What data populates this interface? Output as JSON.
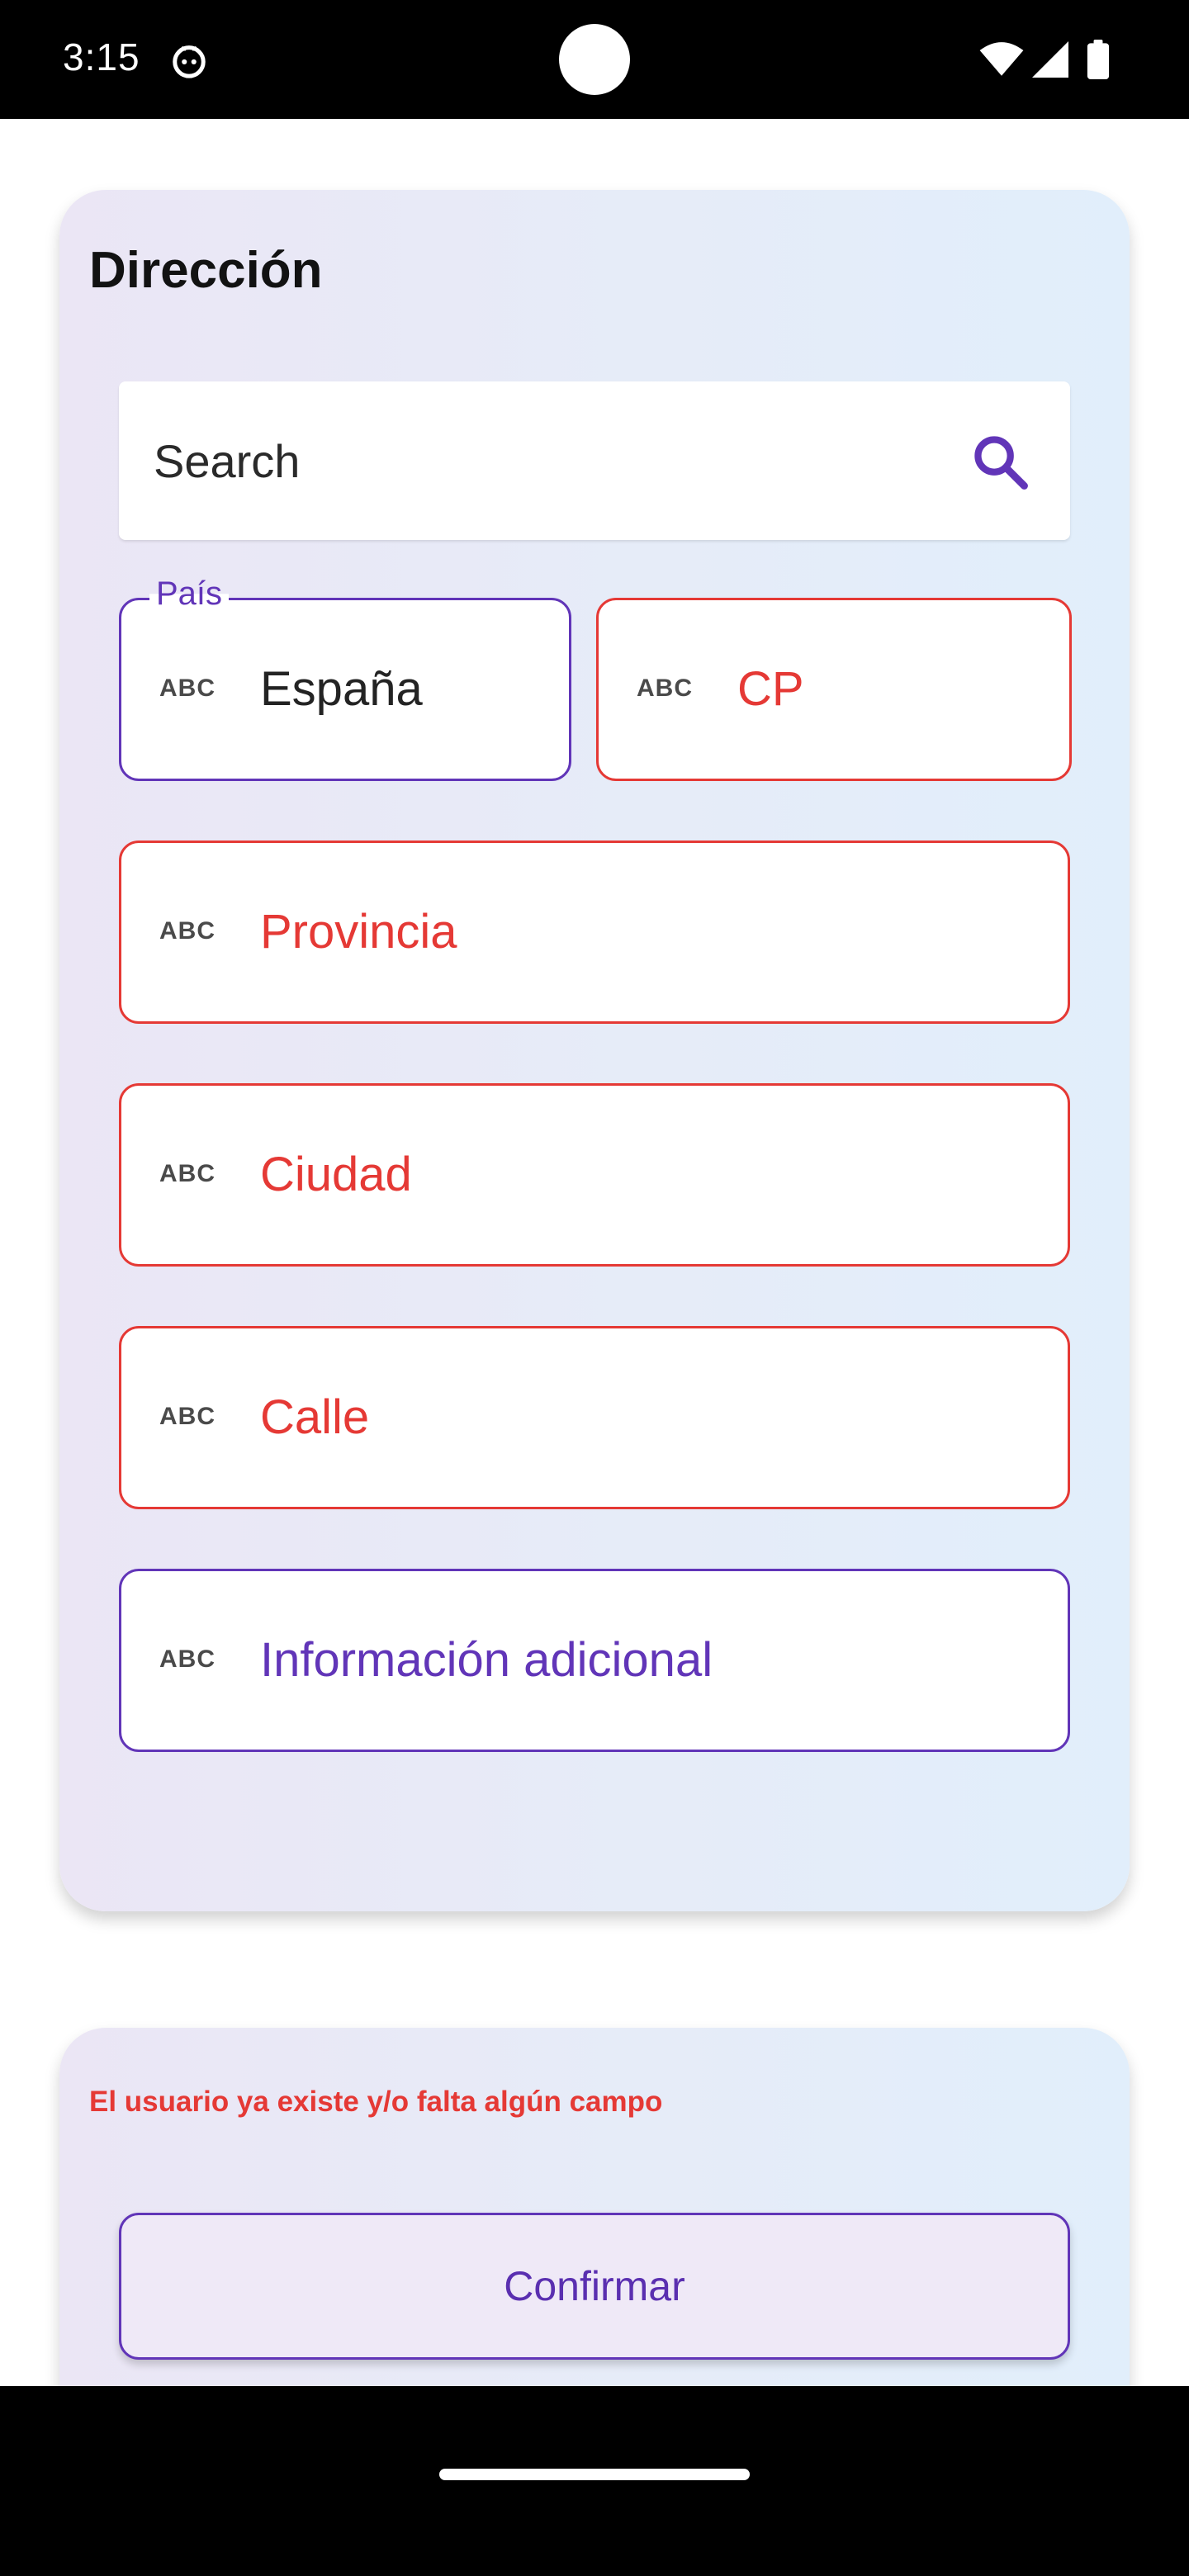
{
  "status_bar": {
    "time": "3:15",
    "icons": [
      "app-notification-icon",
      "wifi-icon",
      "signal-icon",
      "battery-icon"
    ]
  },
  "address_card": {
    "title": "Dirección",
    "search": {
      "placeholder": "Search",
      "icon": "search-icon"
    },
    "fields": {
      "country": {
        "label": "País",
        "value": "España",
        "type_icon": "ABC"
      },
      "postal_code": {
        "placeholder": "CP",
        "type_icon": "ABC"
      },
      "province": {
        "placeholder": "Provincia",
        "type_icon": "ABC"
      },
      "city": {
        "placeholder": "Ciudad",
        "type_icon": "ABC"
      },
      "street": {
        "placeholder": "Calle",
        "type_icon": "ABC"
      },
      "additional_info": {
        "placeholder": "Información adicional",
        "type_icon": "ABC"
      }
    }
  },
  "confirm_card": {
    "error_message": "El usuario ya existe y/o falta algún campo",
    "confirm_label": "Confirmar"
  },
  "colors": {
    "error": "#e53935",
    "accent": "#6135b8",
    "card_gradient_start": "#ebe6f5",
    "card_gradient_end": "#e1eefb"
  }
}
